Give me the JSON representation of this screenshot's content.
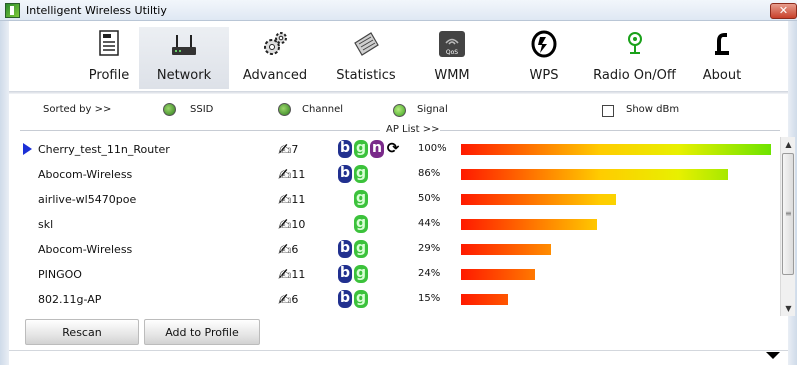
{
  "window": {
    "title": "Intelligent Wireless Utiltiy",
    "close_label": "✕"
  },
  "toolbar": {
    "items": [
      {
        "label": "Profile",
        "icon": "profile-icon",
        "active": false
      },
      {
        "label": "Network",
        "icon": "network-icon",
        "active": true
      },
      {
        "label": "Advanced",
        "icon": "advanced-icon",
        "active": false
      },
      {
        "label": "Statistics",
        "icon": "statistics-icon",
        "active": false
      },
      {
        "label": "WMM",
        "icon": "wmm-icon",
        "active": false
      },
      {
        "label": "WPS",
        "icon": "wps-icon",
        "active": false
      },
      {
        "label": "Radio On/Off",
        "icon": "radio-icon",
        "active": false
      },
      {
        "label": "About",
        "icon": "about-icon",
        "active": false
      }
    ],
    "wmm_icon_text": "QoS\nWMM"
  },
  "sort": {
    "sorted_by_label": "Sorted by >>",
    "ssid_label": "SSID",
    "channel_label": "Channel",
    "signal_label": "Signal",
    "show_dbm_label": "Show dBm",
    "selected": "Signal",
    "show_dbm_checked": false
  },
  "ap_list": {
    "label": "AP List >>",
    "rows": [
      {
        "ssid": "Cherry_test_11n_Router",
        "channel": "7",
        "modes": [
          "b",
          "g",
          "n",
          "wps"
        ],
        "signal": "100%",
        "signal_value": 100,
        "selected": true
      },
      {
        "ssid": "Abocom-Wireless",
        "channel": "11",
        "modes": [
          "b",
          "g"
        ],
        "signal": "86%",
        "signal_value": 86,
        "selected": false
      },
      {
        "ssid": "airlive-wl5470poe",
        "channel": "11",
        "modes": [
          "g"
        ],
        "signal": "50%",
        "signal_value": 50,
        "selected": false
      },
      {
        "ssid": "skl",
        "channel": "10",
        "modes": [
          "g"
        ],
        "signal": "44%",
        "signal_value": 44,
        "selected": false
      },
      {
        "ssid": "Abocom-Wireless",
        "channel": "6",
        "modes": [
          "b",
          "g"
        ],
        "signal": "29%",
        "signal_value": 29,
        "selected": false
      },
      {
        "ssid": "PINGOO",
        "channel": "11",
        "modes": [
          "b",
          "g"
        ],
        "signal": "24%",
        "signal_value": 24,
        "selected": false
      },
      {
        "ssid": "802.11g-AP",
        "channel": "6",
        "modes": [
          "b",
          "g"
        ],
        "signal": "15%",
        "signal_value": 15,
        "selected": false
      }
    ]
  },
  "buttons": {
    "rescan": "Rescan",
    "add_to_profile": "Add to Profile"
  },
  "colors": {
    "selection_arrow": "#1b2fd6",
    "mode_b": "#21308f",
    "mode_g": "#3cc23c",
    "mode_n": "#7a2a8a",
    "bar_start": "#ff1a00",
    "bar_end": "#6ee300"
  }
}
